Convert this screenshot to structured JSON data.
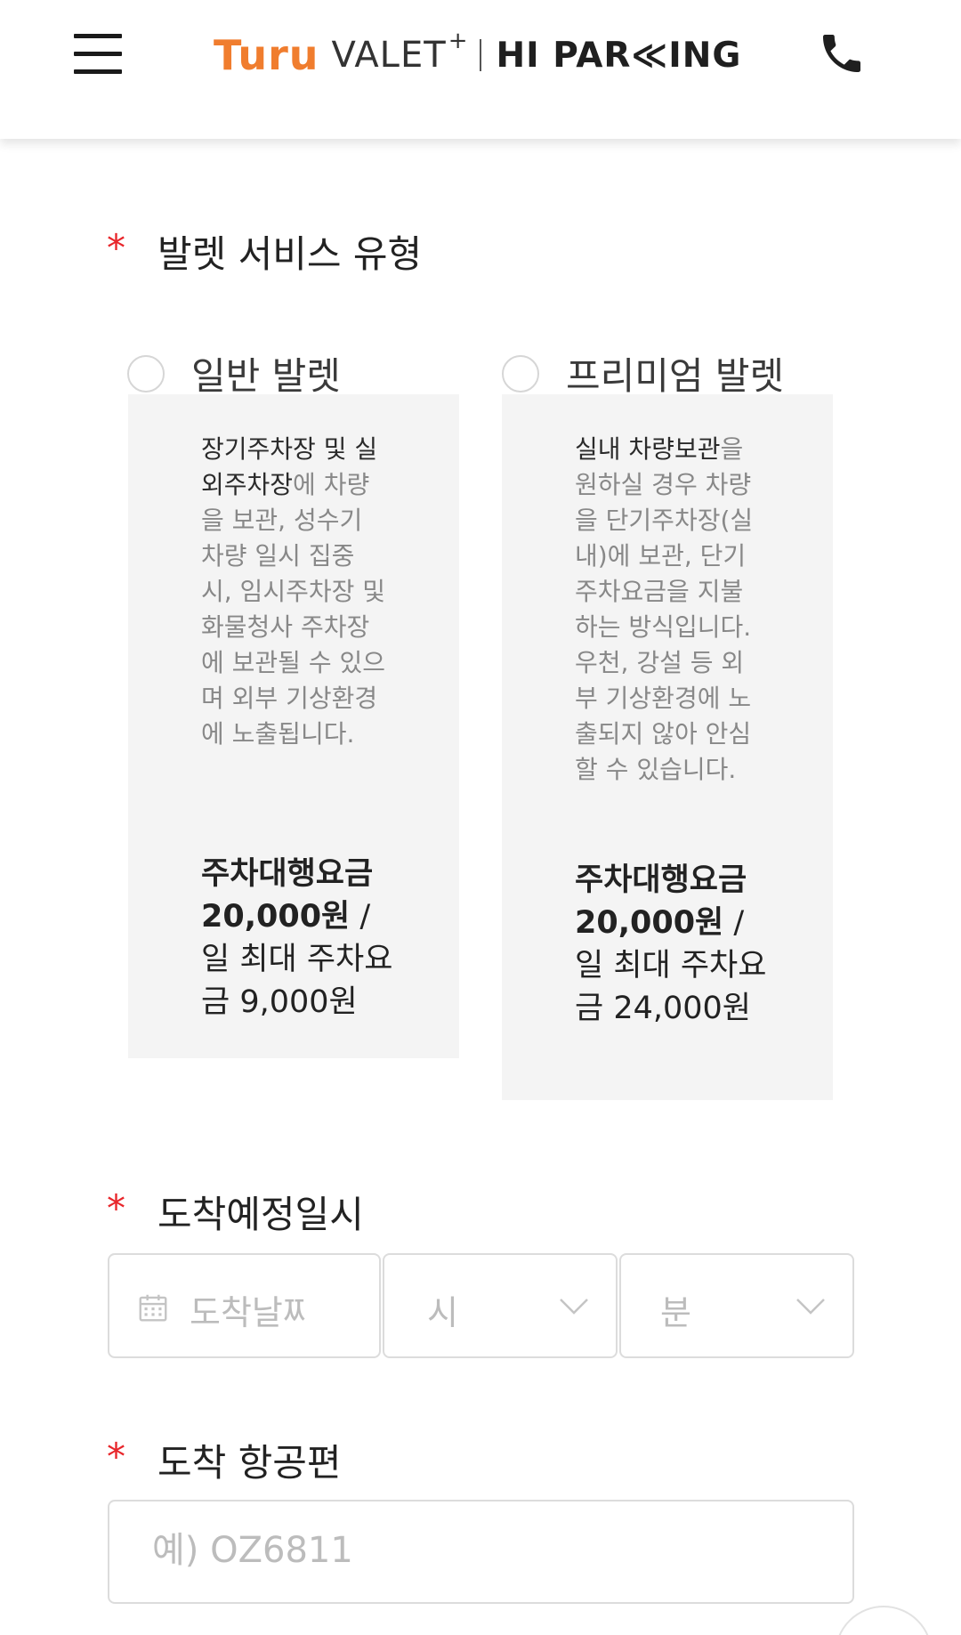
{
  "header": {
    "logo": {
      "turu": "Turu",
      "valet": "VALET",
      "plus": "+",
      "hiparking": "HI PAR≪ING"
    },
    "menu_icon": "hamburger-menu-icon",
    "phone_icon": "phone-icon"
  },
  "colors": {
    "brand_orange": "#f07d2e",
    "required_red": "#e8262b",
    "card_bg": "#f4f4f4"
  },
  "form": {
    "valet_type": {
      "required_mark": "*",
      "label": "발렛 서비스 유형",
      "options": [
        {
          "label": "일반 발렛",
          "selected": false,
          "desc_bold": "장기주차장 및 실외주차장",
          "desc_rest": "에 차량을 보관, 성수기 차량 일시 집중 시, 임시주차장 및 화물청사 주차장에 보관될 수 있으며 외부 기상환경에 노출됩니다.",
          "price_bold": "주차대행요금 20,000원",
          "price_rest": " / 일 최대 주차요금 9,000원"
        },
        {
          "label": "프리미엄 발렛",
          "selected": false,
          "desc_bold": "실내 차량보관",
          "desc_rest": "을 원하실 경우 차량을 단기주차장(실내)에 보관, 단기 주차요금을 지불하는 방식입니다. 우천, 강설 등 외부 기상환경에 노출되지 않아 안심할 수 있습니다.",
          "price_bold": "주차대행요금 20,000원",
          "price_rest": " / 일 최대 주차요금 24,000원"
        }
      ]
    },
    "arrival_datetime": {
      "required_mark": "*",
      "label": "도착예정일시",
      "date_placeholder": "도착날짜",
      "hour_placeholder": "시",
      "minute_placeholder": "분"
    },
    "arrival_flight": {
      "required_mark": "*",
      "label": "도착 항공편",
      "placeholder": "예) OZ6811"
    }
  }
}
